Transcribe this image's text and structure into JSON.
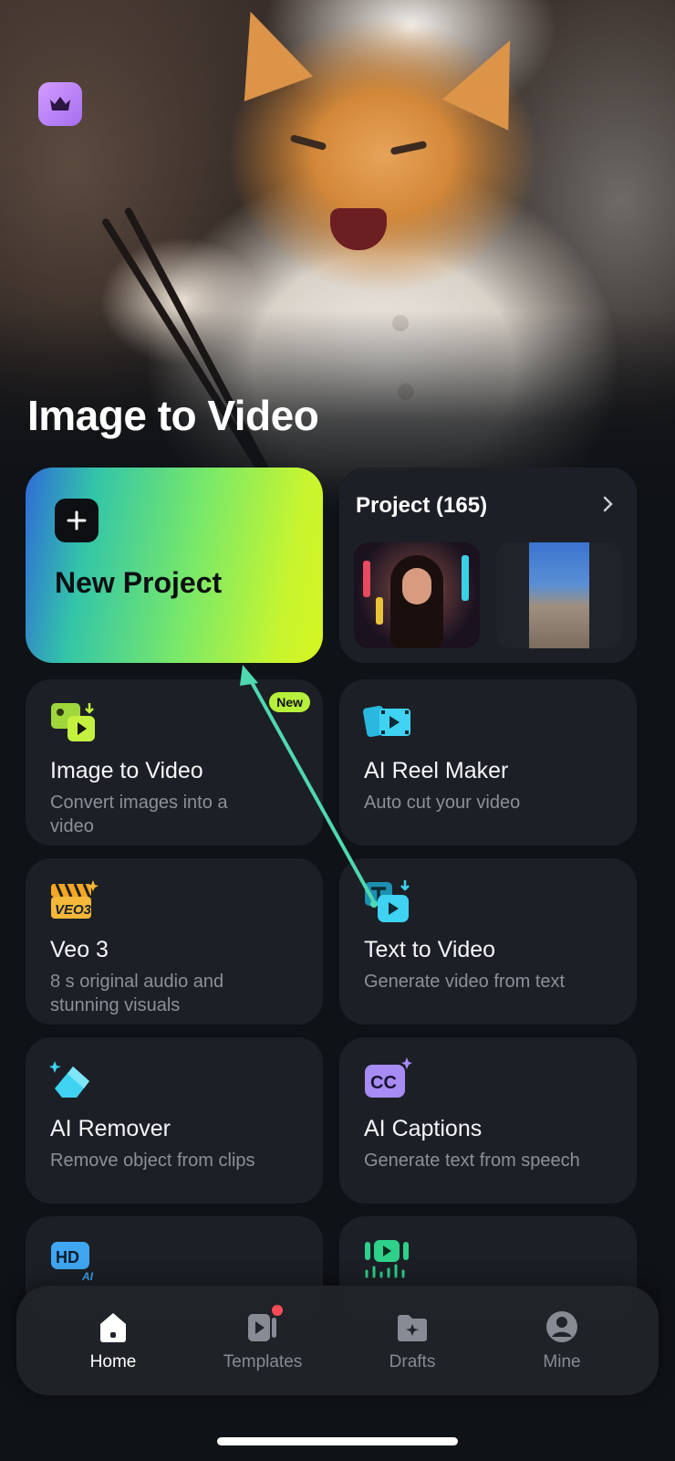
{
  "hero": {
    "title": "Image to Video",
    "premium_icon": "crown-icon"
  },
  "new_project": {
    "label": "New Project",
    "icon": "plus-icon"
  },
  "projects": {
    "title": "Project (165)",
    "icon": "chevron-right-icon"
  },
  "tools": [
    {
      "title": "Image to Video",
      "subtitle": "Convert images into a video",
      "icon": "image-to-video-icon",
      "badge": "New"
    },
    {
      "title": "AI Reel Maker",
      "subtitle": "Auto cut your video",
      "icon": "reel-maker-icon"
    },
    {
      "title": "Veo 3",
      "subtitle": "8 s original audio and stunning visuals",
      "icon": "veo3-icon"
    },
    {
      "title": "Text to Video",
      "subtitle": "Generate video from text",
      "icon": "text-to-video-icon"
    },
    {
      "title": "AI Remover",
      "subtitle": "Remove object from clips",
      "icon": "eraser-icon"
    },
    {
      "title": "AI Captions",
      "subtitle": "Generate text from speech",
      "icon": "captions-cc-icon"
    }
  ],
  "nav": {
    "items": [
      {
        "label": "Home",
        "icon": "home-icon",
        "active": true
      },
      {
        "label": "Templates",
        "icon": "templates-icon",
        "notification": true
      },
      {
        "label": "Drafts",
        "icon": "drafts-folder-icon"
      },
      {
        "label": "Mine",
        "icon": "profile-icon"
      }
    ]
  },
  "colors": {
    "background": "#0f1216",
    "card": "#1c2026",
    "accent_green": "#b6f03a",
    "annotation_arrow": "#4fd8b0",
    "notification": "#ff4b55"
  }
}
